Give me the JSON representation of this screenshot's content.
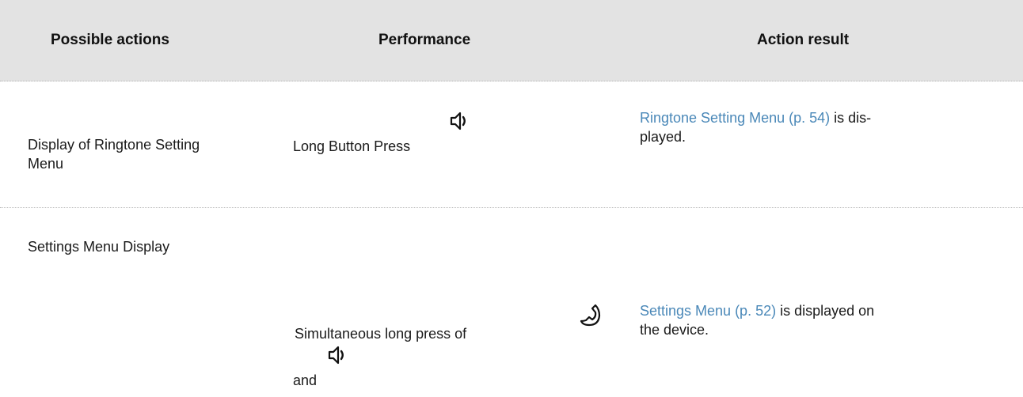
{
  "header": {
    "col_actions": "Possible actions",
    "col_performance": "Performance",
    "col_result": "Action result"
  },
  "rows": [
    {
      "action": "Display of Ringtone Setting Menu",
      "performance": "Long Button Press",
      "performance_icon": "speaker-icon",
      "result_link": "Ringtone Setting Menu (p. 54)",
      "result_text_1": " is dis-",
      "result_text_2": "played."
    },
    {
      "action": "Settings Menu Display",
      "performance_1": "Simultaneous long press of",
      "performance_icon_1": "handset-icon",
      "performance_2": "and",
      "performance_icon_2": "speaker-icon",
      "result_link": "Settings Menu (p. 52)",
      "result_text_1": " is displayed on",
      "result_text_2": "the device."
    }
  ]
}
